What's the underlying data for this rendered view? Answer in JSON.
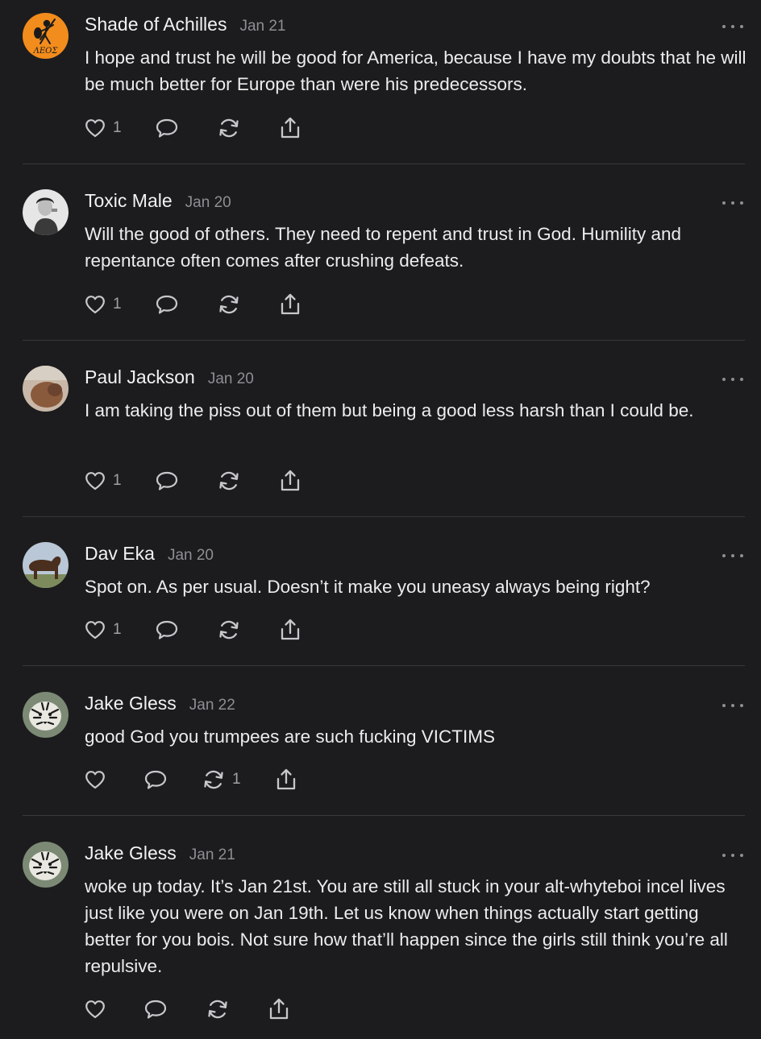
{
  "comments": [
    {
      "author": "Shade of Achilles",
      "date": "Jan 21",
      "text": "I hope and trust he will be good for America, because I have my doubts that he will be much better for Europe than were his predecessors.",
      "likes": "1",
      "restacks": "",
      "avatar": "spartan-warrior-logo",
      "avatar_bg": "#f28c1c"
    },
    {
      "author": "Toxic Male",
      "date": "Jan 20",
      "text": "Will the good of others. They need to repent and trust in God. Humility and repentance often comes after crushing defeats.",
      "likes": "1",
      "restacks": "",
      "avatar": "man-portrait-photo",
      "avatar_bg": "#d9d9d9"
    },
    {
      "author": "Paul Jackson",
      "date": "Jan 20",
      "text": "I am taking the piss out of them but being a good less harsh than I could be.",
      "likes": "1",
      "restacks": "",
      "avatar": "dog-photo",
      "avatar_bg": "#8a6a55"
    },
    {
      "author": "Dav Eka",
      "date": "Jan 20",
      "text": "Spot on. As per usual. Doesn’t it make you uneasy always being right?",
      "likes": "1",
      "restacks": "",
      "avatar": "horse-photo",
      "avatar_bg": "#9fb3c8"
    },
    {
      "author": "Jake Gless",
      "date": "Jan 22",
      "text": "good God you trumpees are such fucking VICTIMS",
      "likes": "",
      "restacks": "1",
      "avatar": "tiger-illustration",
      "avatar_bg": "#6f7a6a"
    },
    {
      "author": "Jake Gless",
      "date": "Jan 21",
      "text": "woke up today. It’s Jan 21st. You are still all stuck in your alt-whyteboi incel lives just like you were on Jan 19th. Let us know when things actually start getting better for you bois. Not sure how that’ll happen since the girls still think you’re all repulsive.",
      "likes": "",
      "restacks": "",
      "avatar": "tiger-illustration",
      "avatar_bg": "#6f7a6a"
    }
  ],
  "icons": {
    "like": "heart-icon",
    "reply": "speech-bubble-icon",
    "restack": "restack-arrows-icon",
    "share": "share-upload-icon",
    "more": "more-dots-icon"
  },
  "colors": {
    "background": "#1c1c1e",
    "text": "#ececec",
    "muted": "#8e8e93",
    "divider": "#38383a"
  }
}
